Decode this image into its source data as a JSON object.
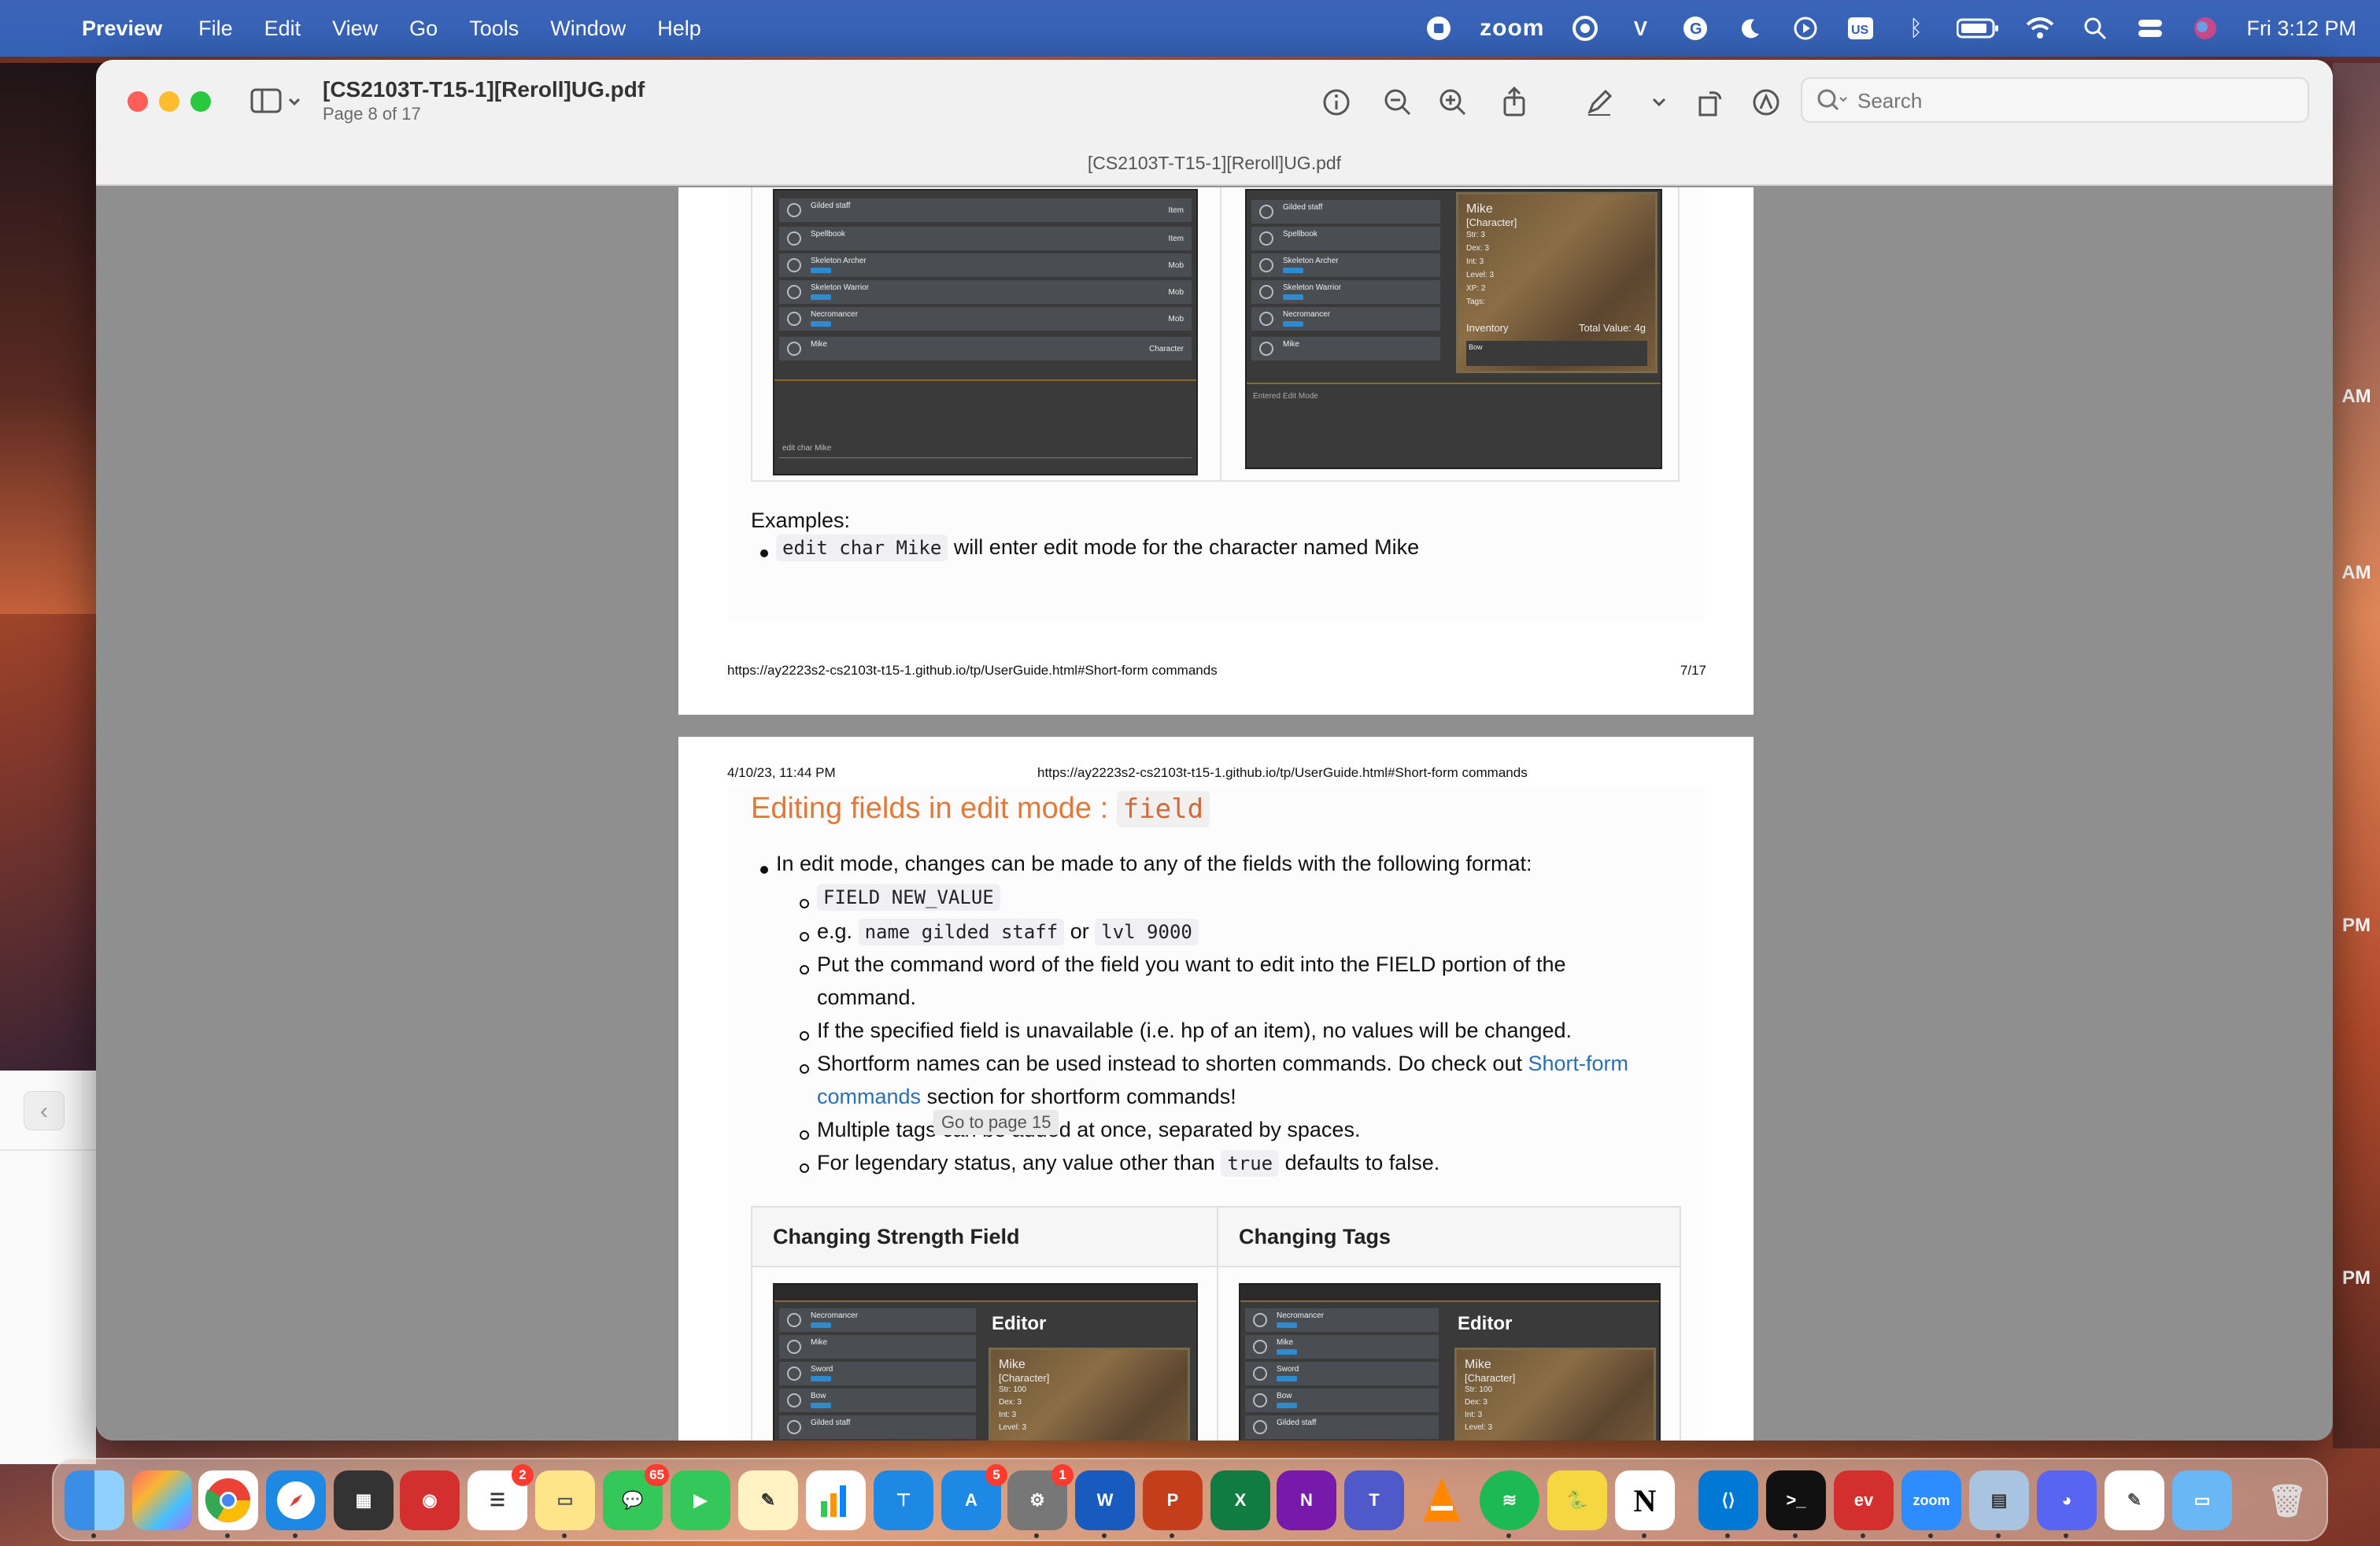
{
  "menubar": {
    "app_name": "Preview",
    "items": [
      "File",
      "Edit",
      "View",
      "Go",
      "Tools",
      "Window",
      "Help"
    ],
    "zoom_label": "zoom",
    "clock": "Fri 3:12 PM"
  },
  "window": {
    "title": "[CS2103T-T15-1][Reroll]UG.pdf",
    "page_indicator": "Page 8 of 17",
    "doc_subtitle": "[CS2103T-T15-1][Reroll]UG.pdf",
    "search_placeholder": "Search"
  },
  "page1": {
    "screenshot_left_rows": [
      {
        "name": "Gilded staff",
        "type": "Item"
      },
      {
        "name": "Spellbook",
        "type": "Item"
      },
      {
        "name": "Skeleton Archer",
        "type": "Mob"
      },
      {
        "name": "Skeleton Warrior",
        "type": "Mob"
      },
      {
        "name": "Necromancer",
        "type": "Mob"
      },
      {
        "name": "Mike",
        "type": "Character"
      }
    ],
    "screenshot_left_input": "edit char Mike",
    "screenshot_right_rows": [
      "Gilded staff",
      "Spellbook",
      "Skeleton Archer",
      "Skeleton Warrior",
      "Necromancer",
      "Mike"
    ],
    "screenshot_right_status": "Entered Edit Mode",
    "editor_card": {
      "name": "Mike",
      "kind": "[Character]",
      "stats": [
        "Str: 3",
        "Dex: 3",
        "Int: 3",
        "Level: 3",
        "XP: 2",
        "Tags:"
      ],
      "inventory_label": "Inventory",
      "total_value": "Total Value: 4g",
      "inventory_item": "Bow"
    },
    "examples_label": "Examples:",
    "example_code": "edit char Mike",
    "example_text": "will enter edit mode for the character named Mike",
    "footer_url": "https://ay2223s2-cs2103t-t15-1.github.io/tp/UserGuide.html#Short-form commands",
    "footer_page": "7/17"
  },
  "page2": {
    "header_date": "4/10/23, 11:44 PM",
    "header_url": "https://ay2223s2-cs2103t-t15-1.github.io/tp/UserGuide.html#Short-form commands",
    "heading_text": "Editing fields in edit mode :",
    "heading_code": "field",
    "bullet_main": "In edit mode, changes can be made to any of the fields with the following format:",
    "sub_format_code": "FIELD NEW_VALUE",
    "sub_eg_prefix": "e.g.",
    "sub_eg_code1": "name gilded staff",
    "sub_eg_or": "or",
    "sub_eg_code2": "lvl 9000",
    "sub_put_line1": "Put the command word of the field you want to edit into the FIELD portion of the",
    "sub_put_line2": "command.",
    "sub_unavailable": "If the specified field is unavailable (i.e. hp of an item), no values will be changed.",
    "sub_short_line1": "Shortform names can be used instead to shorten commands. Do check out",
    "sub_short_link1": "Short-form",
    "sub_short_link2": "commands",
    "sub_short_line2": "section for shortform commands!",
    "sub_tags": "Multiple tags can be added at once, separated by spaces.",
    "sub_legendary_prefix": "For legendary status, any value other than",
    "sub_legendary_code": "true",
    "sub_legendary_suffix": "defaults to false.",
    "tooltip": "Go to page 15",
    "table_headers": [
      "Changing Strength Field",
      "Changing Tags"
    ],
    "editor_title": "Editor",
    "mini_card": {
      "name": "Mike",
      "kind": "[Character]",
      "stats": [
        "Str: 100",
        "Dex: 3",
        "Int: 3",
        "Level: 3"
      ]
    },
    "mini_rows": [
      "Necromancer",
      "Mike",
      "Sword",
      "Bow",
      "Gilded staff"
    ]
  },
  "side_times": [
    "AM",
    "AM",
    "PM",
    "PM"
  ],
  "dock": {
    "badges": {
      "reminders": "2",
      "messages": "65",
      "appstore": "5",
      "settings": "1"
    },
    "zoom_label": "zoom"
  }
}
